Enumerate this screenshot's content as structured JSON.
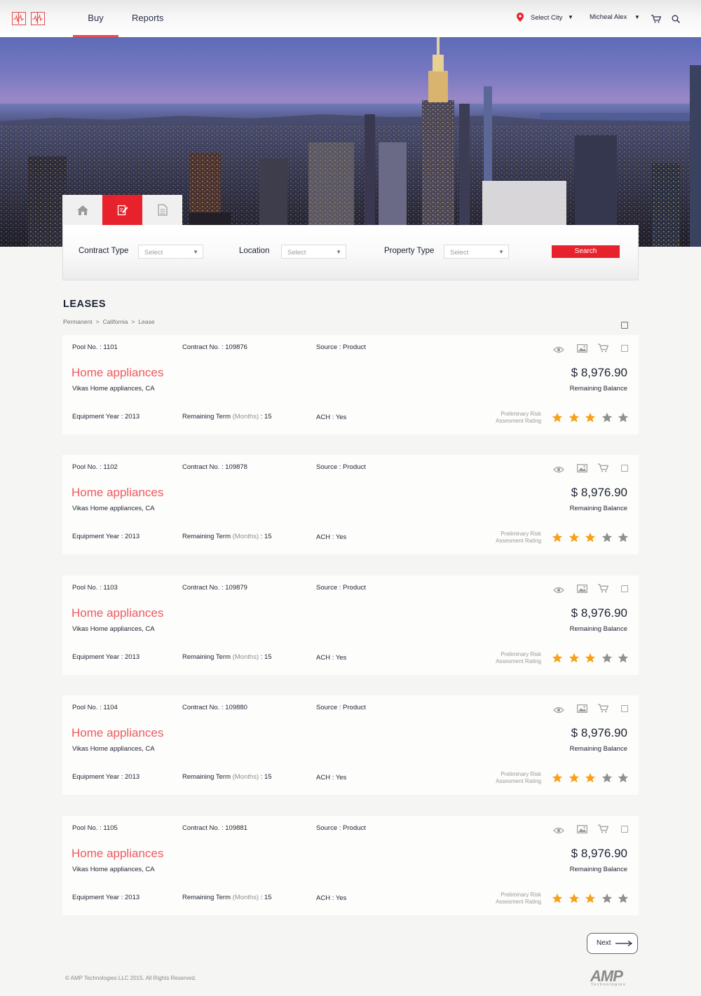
{
  "header": {
    "nav": [
      {
        "label": "Buy",
        "active": true
      },
      {
        "label": "Reports",
        "active": false
      }
    ],
    "city_label": "Select City",
    "user_name": "Micheal Alex",
    "icons": [
      "app-logo-icon",
      "location-pin-icon",
      "chevron-down-icon",
      "cart-icon",
      "search-icon"
    ]
  },
  "tabs": [
    {
      "icon": "home-icon",
      "active": false
    },
    {
      "icon": "edit-document-icon",
      "active": true
    },
    {
      "icon": "document-icon",
      "active": false
    }
  ],
  "search": {
    "contract_type_label": "Contract Type",
    "location_label": "Location",
    "property_type_label": "Property Type",
    "select_placeholder": "Select",
    "search_button": "Search"
  },
  "section": {
    "title": "LEASES",
    "breadcrumb": [
      "Permanent",
      "California",
      "Lease"
    ],
    "breadcrumb_sep": ">"
  },
  "labels": {
    "pool_no": "Pool No. :",
    "contract_no": "Contract No. :",
    "source": "Source :",
    "equipment_year": "Equipment Year :",
    "remaining_term": "Remaining Term",
    "months": "(Months)",
    "ach": "ACH :",
    "remaining_balance": "Remaining Balance",
    "risk_line1": "Preliminary Risk",
    "risk_line2": "Assesment Rating"
  },
  "leases": [
    {
      "pool_no": "1101",
      "contract_no": "109876",
      "source": "Product",
      "title": "Home appliances",
      "location": "Vikas Home appliances, CA",
      "amount": "$ 8,976.90",
      "equipment_year": "2013",
      "remaining_term": "15",
      "ach": "Yes",
      "rating": 3,
      "rating_max": 5
    },
    {
      "pool_no": "1102",
      "contract_no": "109878",
      "source": "Product",
      "title": "Home appliances",
      "location": "Vikas Home appliances, CA",
      "amount": "$ 8,976.90",
      "equipment_year": "2013",
      "remaining_term": "15",
      "ach": "Yes",
      "rating": 3,
      "rating_max": 5
    },
    {
      "pool_no": "1103",
      "contract_no": "109879",
      "source": "Product",
      "title": "Home appliances",
      "location": "Vikas Home appliances, CA",
      "amount": "$ 8,976.90",
      "equipment_year": "2013",
      "remaining_term": "15",
      "ach": "Yes",
      "rating": 3,
      "rating_max": 5
    },
    {
      "pool_no": "1104",
      "contract_no": "109880",
      "source": "Product",
      "title": "Home appliances",
      "location": "Vikas Home appliances, CA",
      "amount": "$ 8,976.90",
      "equipment_year": "2013",
      "remaining_term": "15",
      "ach": "Yes",
      "rating": 3,
      "rating_max": 5
    },
    {
      "pool_no": "1105",
      "contract_no": "109881",
      "source": "Product",
      "title": "Home appliances",
      "location": "Vikas Home appliances, CA",
      "amount": "$ 8,976.90",
      "equipment_year": "2013",
      "remaining_term": "15",
      "ach": "Yes",
      "rating": 3,
      "rating_max": 5
    }
  ],
  "pagination": {
    "next_label": "Next"
  },
  "footer": {
    "copyright": "© AMP Technologies LLC 2015. All Rights Reserved.",
    "logo_text": "AMP",
    "logo_sub": "Technologies"
  },
  "colors": {
    "accent": "#e8222c",
    "title_red": "#ef5860",
    "star_on": "#f7a11a",
    "star_off": "#8f8f8f",
    "text_dark": "#1c2233"
  }
}
